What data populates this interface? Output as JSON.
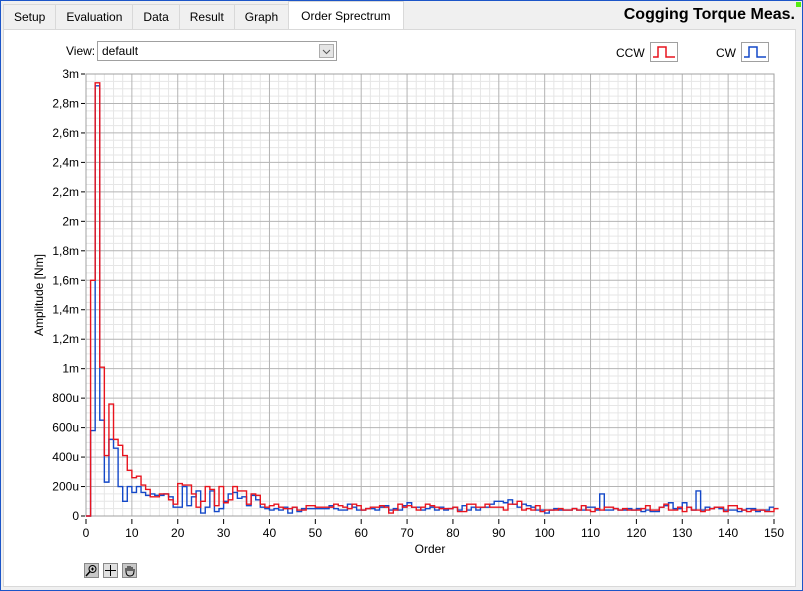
{
  "window": {
    "title": "Cogging Torque Meas.",
    "status_led_color": "#55ee11"
  },
  "tabs": [
    {
      "label": "Setup",
      "active": false
    },
    {
      "label": "Evaluation",
      "active": false
    },
    {
      "label": "Data",
      "active": false
    },
    {
      "label": "Result",
      "active": false
    },
    {
      "label": "Graph",
      "active": false
    },
    {
      "label": "Order Sprectrum",
      "active": true
    }
  ],
  "view": {
    "label": "View:",
    "selected": "default"
  },
  "legend": [
    {
      "name": "CCW",
      "color": "#e8141e"
    },
    {
      "name": "CW",
      "color": "#1448c8"
    }
  ],
  "toolbar": {
    "zoom_tool": "zoom-icon",
    "cursor_tool": "crosshair-icon",
    "pan_tool": "hand-icon"
  },
  "chart_data": {
    "type": "line",
    "style": "step",
    "title": "",
    "xlabel": "Order",
    "ylabel": "Amplitude [Nm]",
    "xlim": [
      0,
      150
    ],
    "ylim": [
      0,
      0.003
    ],
    "grid": true,
    "x_ticks": [
      0,
      10,
      20,
      30,
      40,
      50,
      60,
      70,
      80,
      90,
      100,
      110,
      120,
      130,
      140,
      150
    ],
    "x_tick_labels": [
      "0",
      "10",
      "20",
      "30",
      "40",
      "50",
      "60",
      "70",
      "80",
      "90",
      "100",
      "110",
      "120",
      "130",
      "140",
      "150"
    ],
    "y_ticks": [
      0,
      0.0002,
      0.0004,
      0.0006,
      0.0008,
      0.001,
      0.0012,
      0.0014,
      0.0016,
      0.0018,
      0.002,
      0.0022,
      0.0024,
      0.0026,
      0.0028,
      0.003
    ],
    "y_tick_labels": [
      "0",
      "200u",
      "400u",
      "600u",
      "800u",
      "1m",
      "1,2m",
      "1,4m",
      "1,6m",
      "1,8m",
      "2m",
      "2,2m",
      "2,4m",
      "2,6m",
      "2,8m",
      "3m"
    ],
    "legend_position": "top-right",
    "series": [
      {
        "name": "CCW",
        "color": "#e8141e",
        "values_uNm": [
          0,
          1600,
          2940,
          1010,
          410,
          760,
          520,
          480,
          410,
          310,
          260,
          270,
          210,
          180,
          130,
          130,
          150,
          150,
          110,
          80,
          220,
          210,
          210,
          150,
          60,
          100,
          200,
          180,
          70,
          200,
          90,
          110,
          200,
          170,
          170,
          80,
          150,
          140,
          80,
          60,
          70,
          80,
          60,
          50,
          50,
          60,
          40,
          40,
          70,
          70,
          60,
          60,
          60,
          60,
          80,
          70,
          60,
          50,
          80,
          70,
          40,
          50,
          60,
          60,
          70,
          60,
          20,
          40,
          80,
          60,
          70,
          60,
          40,
          60,
          80,
          70,
          60,
          50,
          50,
          50,
          60,
          30,
          30,
          80,
          80,
          60,
          60,
          80,
          60,
          60,
          60,
          40,
          80,
          80,
          100,
          40,
          50,
          40,
          70,
          30,
          40,
          40,
          40,
          50,
          40,
          40,
          50,
          40,
          70,
          40,
          30,
          50,
          40,
          60,
          60,
          50,
          40,
          50,
          40,
          40,
          40,
          50,
          70,
          40,
          40,
          60,
          80,
          40,
          40,
          60,
          30,
          60,
          40,
          40,
          30,
          40,
          50,
          60,
          60,
          30,
          70,
          70,
          50,
          40,
          30,
          40,
          40,
          40,
          30,
          30,
          50,
          50
        ],
        "values": []
      },
      {
        "name": "CW",
        "color": "#1448c8",
        "values_uNm": [
          0,
          580,
          2920,
          650,
          230,
          520,
          460,
          200,
          100,
          200,
          160,
          200,
          160,
          140,
          150,
          140,
          140,
          150,
          130,
          60,
          60,
          200,
          70,
          130,
          170,
          20,
          60,
          170,
          30,
          50,
          100,
          150,
          160,
          120,
          130,
          70,
          140,
          110,
          60,
          50,
          40,
          50,
          40,
          60,
          20,
          60,
          30,
          50,
          50,
          50,
          50,
          50,
          50,
          70,
          50,
          40,
          40,
          80,
          60,
          40,
          40,
          50,
          50,
          40,
          60,
          70,
          40,
          50,
          40,
          70,
          90,
          60,
          60,
          40,
          50,
          60,
          40,
          60,
          40,
          50,
          60,
          40,
          70,
          40,
          60,
          40,
          60,
          60,
          80,
          100,
          100,
          90,
          110,
          80,
          60,
          80,
          70,
          60,
          40,
          40,
          20,
          40,
          50,
          40,
          40,
          40,
          50,
          40,
          40,
          60,
          60,
          40,
          150,
          40,
          40,
          50,
          40,
          40,
          50,
          40,
          50,
          30,
          40,
          30,
          30,
          60,
          70,
          90,
          50,
          50,
          90,
          60,
          40,
          170,
          40,
          60,
          50,
          60,
          50,
          40,
          40,
          40,
          30,
          40,
          50,
          50,
          30,
          40,
          40,
          60
        ]
      }
    ]
  }
}
